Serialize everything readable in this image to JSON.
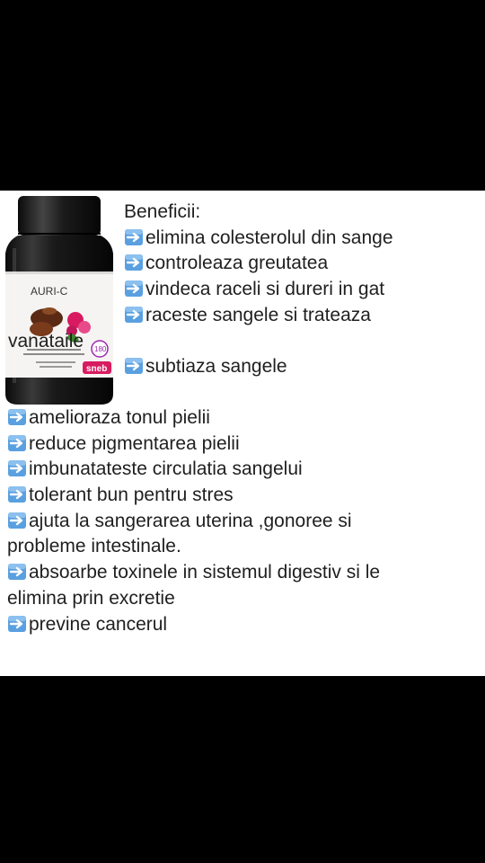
{
  "product": {
    "brand": "AURI-C",
    "badge": "180",
    "logo": "sneb",
    "colors": {
      "jar": "#151515",
      "label": "#f6f4f2",
      "accent": "#d81b60",
      "arrow_tile": "#5aa0e0"
    }
  },
  "benefits": {
    "heading": "Beneficii:",
    "top_items": [
      "elimina colesterolul din sange",
      "controleaza greutatea",
      "vindeca raceli si dureri in gat",
      "raceste sangele si trateaza",
      "subtiaza sangele"
    ],
    "top_item_3_continuation": "vanataile",
    "bottom_items": [
      "amelioraza tonul pielii",
      "reduce pigmentarea pielii",
      "imbunatateste circulatia sangelui",
      "tolerant bun pentru stres",
      "ajuta la sangerarea uterina ,gonoree si",
      "absoarbe toxinele in sistemul digestiv si le",
      "previne cancerul"
    ],
    "bottom_item_4_continuation": "probleme intestinale.",
    "bottom_item_5_continuation": "elimina prin excretie",
    "arrow_icon": "right-arrow-emoji-icon"
  }
}
